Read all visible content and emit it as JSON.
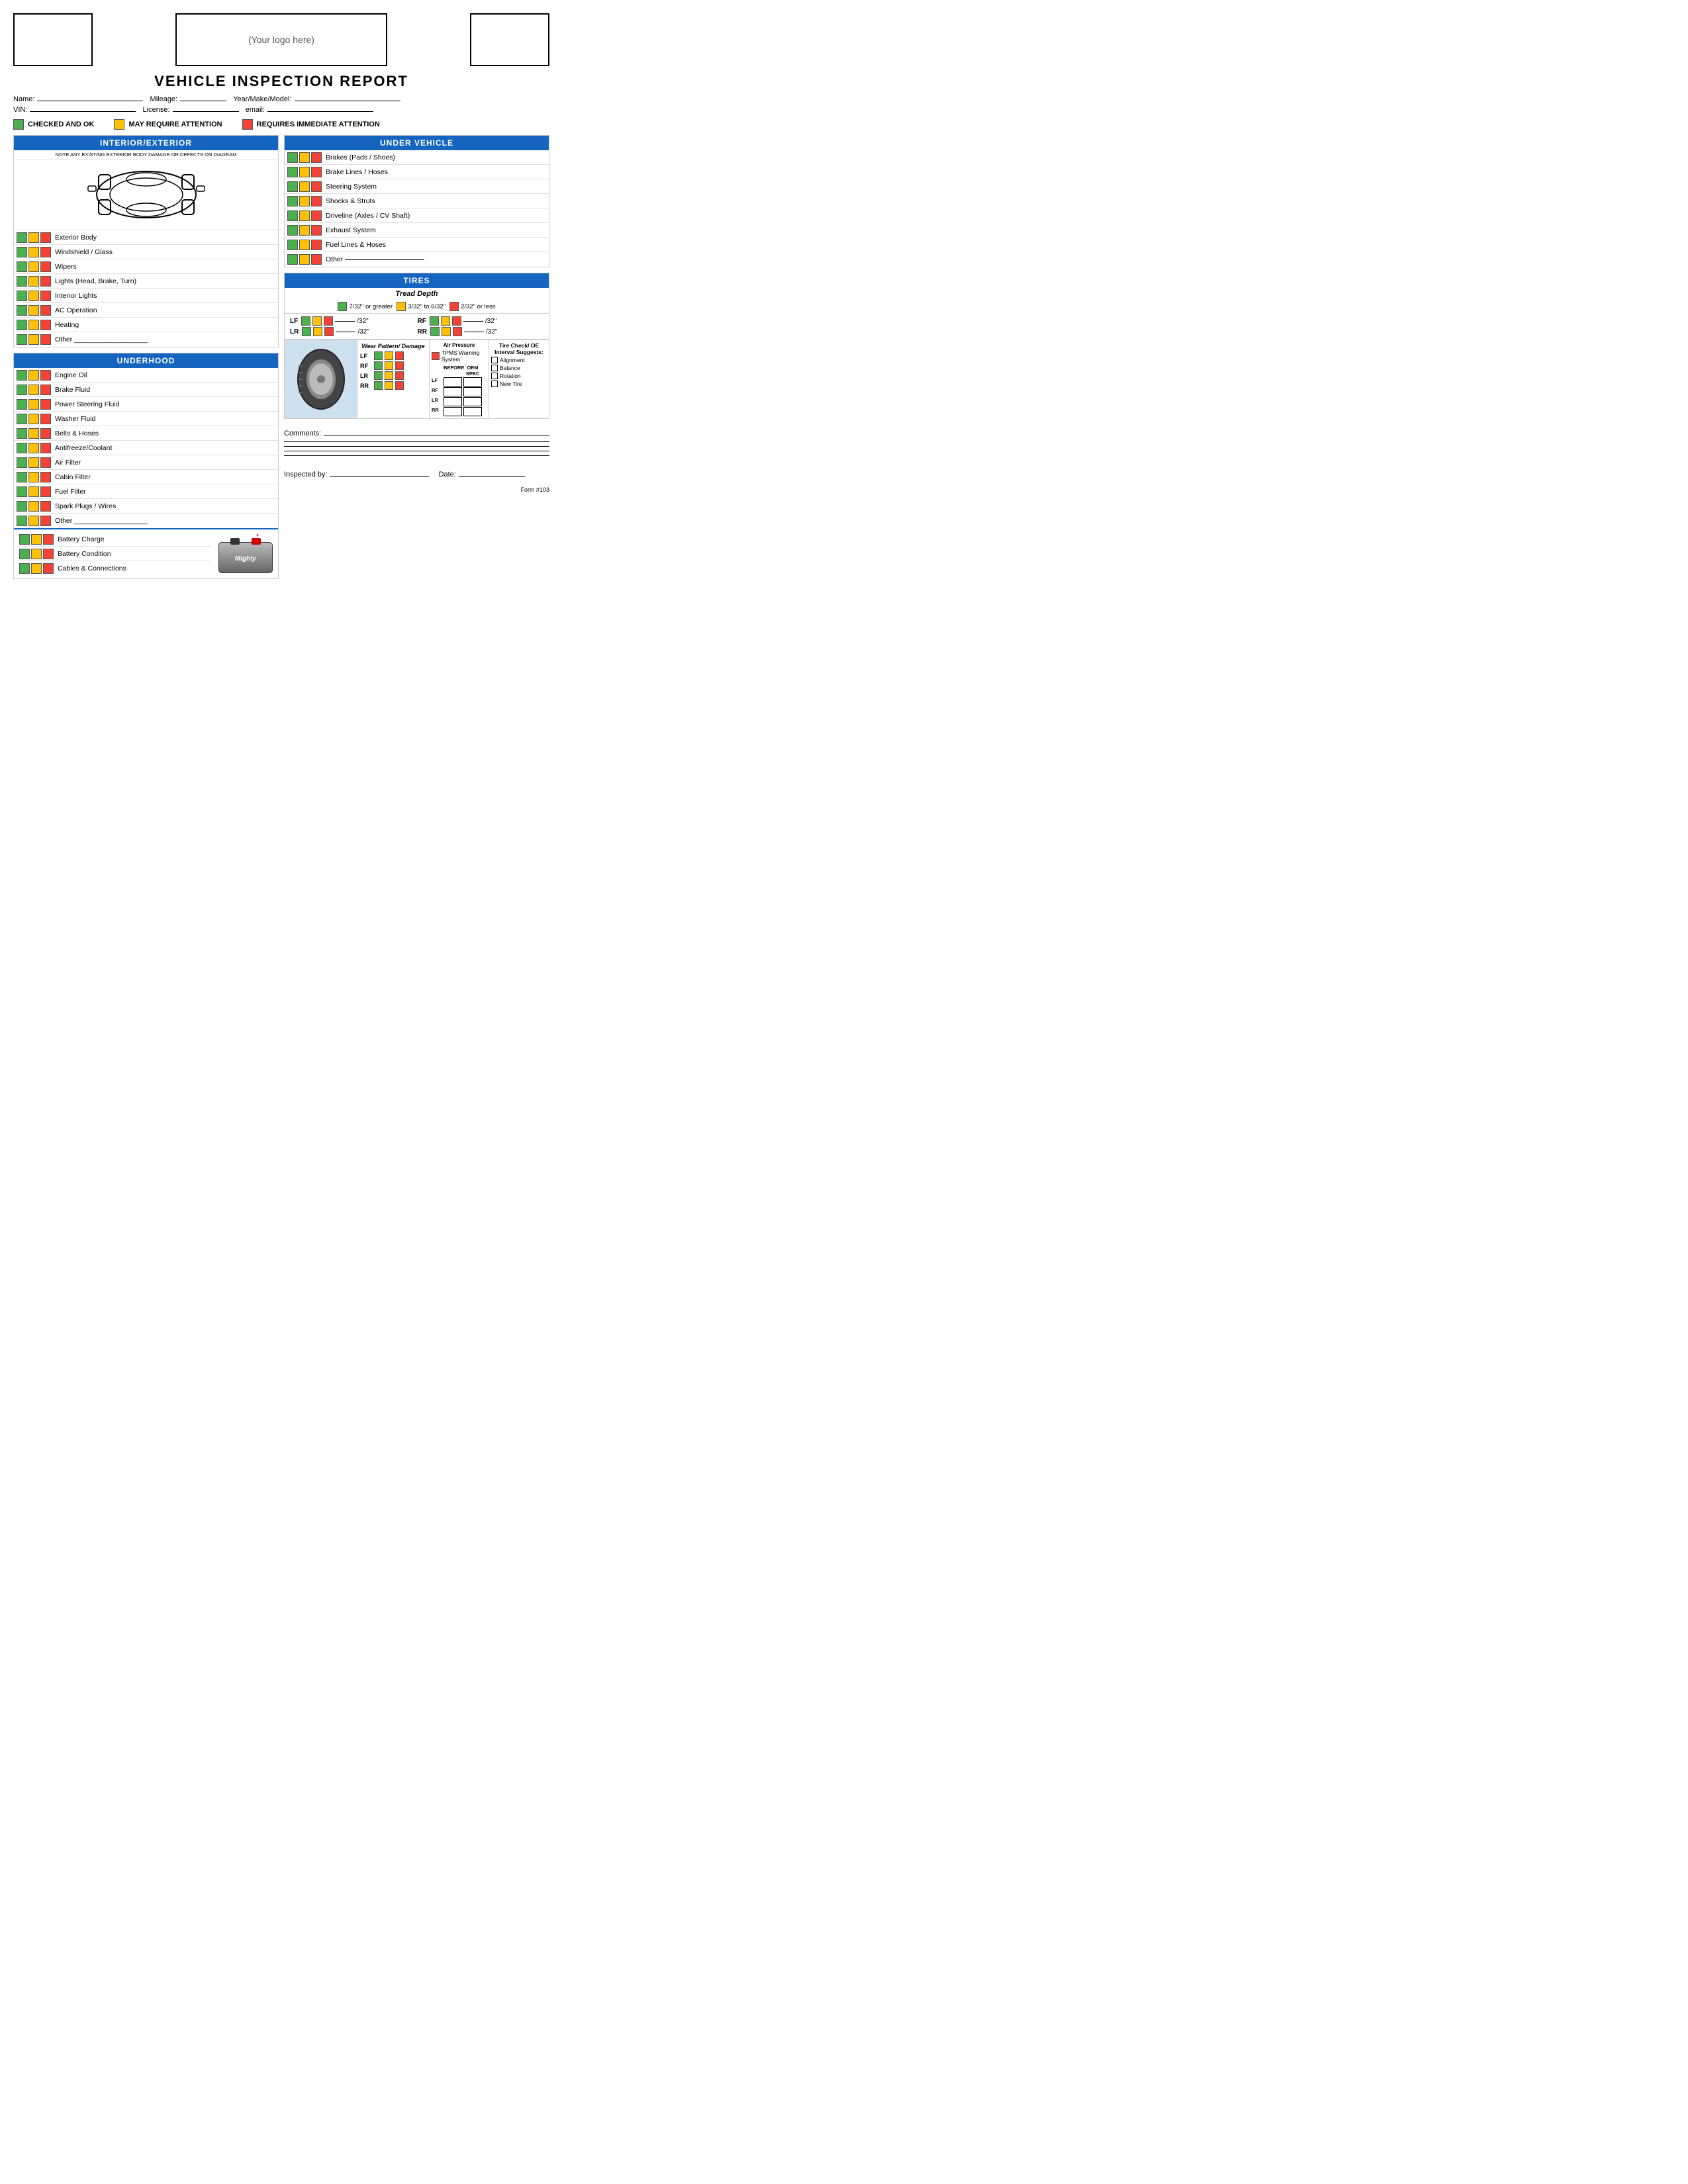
{
  "header": {
    "logo_text": "(Your logo here)"
  },
  "title": "VEHICLE INSPECTION REPORT",
  "form_fields": {
    "name_label": "Name:",
    "mileage_label": "Mileage:",
    "year_make_model_label": "Year/Make/Model:",
    "vin_label": "VIN:",
    "license_label": "License:",
    "email_label": "email:"
  },
  "legend": {
    "green_label": "CHECKED AND OK",
    "yellow_label": "MAY REQUIRE ATTENTION",
    "red_label": "REQUIRES IMMEDIATE ATTENTION"
  },
  "interior_exterior": {
    "header": "INTERIOR/EXTERIOR",
    "note": "NOTE ANY EXISTING EXTERIOR BODY DAMAGE OR DEFECTS ON DIAGRAM",
    "items": [
      "Exterior Body",
      "Windshield / Glass",
      "Wipers",
      "Lights (Head, Brake, Turn)",
      "Interior Lights",
      "AC Operation",
      "Heating",
      "Other ___________________"
    ]
  },
  "underhood": {
    "header": "UNDERHOOD",
    "items": [
      "Engine Oil",
      "Brake Fluid",
      "Power Steering Fluid",
      "Washer Fluid",
      "Belts & Hoses",
      "Antifreeze/Coolant",
      "Air Filter",
      "Cabin Filter",
      "Fuel Filter",
      "Spark Plugs / Wires",
      "Other ___________________"
    ],
    "battery_items": [
      "Battery Charge",
      "Battery Condition",
      "Cables & Connections"
    ]
  },
  "under_vehicle": {
    "header": "UNDER VEHICLE",
    "items": [
      "Brakes (Pads / Shoes)",
      "Brake Lines / Hoses",
      "Steering System",
      "Shocks & Struts",
      "Driveline (Axles / CV Shaft)",
      "Exhaust System",
      "Fuel Lines & Hoses",
      "Other"
    ]
  },
  "tires": {
    "header": "TIRES",
    "tread_depth_title": "Tread Depth",
    "tread_legend": [
      {
        "color": "green",
        "label": "7/32\" or greater"
      },
      {
        "color": "yellow",
        "label": "3/32\" to 6/32\""
      },
      {
        "color": "red",
        "label": "2/32\" or less"
      }
    ],
    "readings": [
      {
        "pos": "LF",
        "unit": "/32\""
      },
      {
        "pos": "RF",
        "unit": "/32\""
      },
      {
        "pos": "LR",
        "unit": "/32\""
      },
      {
        "pos": "RR",
        "unit": "/32\""
      }
    ],
    "wear_pattern_title": "Wear Pattern/ Damage",
    "wear_positions": [
      "LF",
      "RF",
      "LR",
      "RR"
    ],
    "air_pressure_title": "Air Pressure",
    "tpms_label": "TPMS Warning System",
    "pressure_headers": [
      "BEFORE",
      "OEM SPEC"
    ],
    "pressure_positions": [
      "LF",
      "RF",
      "LR",
      "RR"
    ],
    "tire_check_title": "Tire Check/ OE Interval Suggests:",
    "tire_check_items": [
      "Alignment",
      "Balance",
      "Rotation",
      "New Tire"
    ]
  },
  "comments": {
    "label": "Comments:"
  },
  "footer": {
    "inspected_by": "Inspected by:",
    "date": "Date:",
    "form_number": "Form #103"
  }
}
